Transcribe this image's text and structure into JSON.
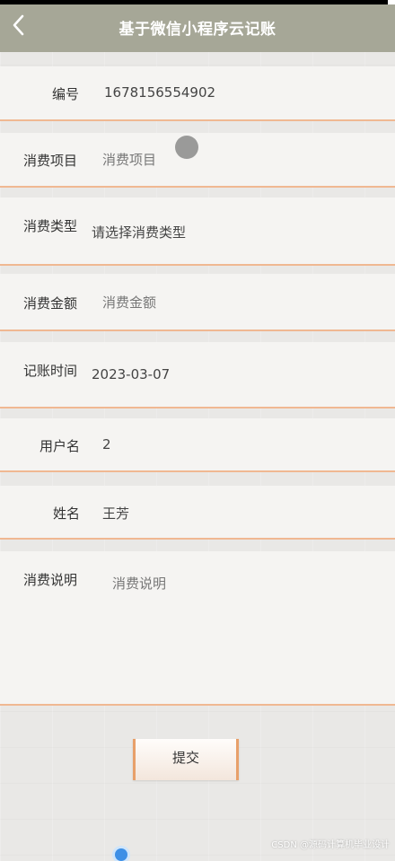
{
  "header": {
    "title": "基于微信小程序云记账",
    "back_icon": "chevron-left-icon"
  },
  "form": {
    "id_label": "编号",
    "id_value": "1678156554902",
    "item_label": "消费项目",
    "item_placeholder": "消费项目",
    "type_label": "消费类型",
    "type_placeholder": "请选择消费类型",
    "amount_label": "消费金额",
    "amount_placeholder": "消费金额",
    "date_label": "记账时间",
    "date_value": "2023-03-07",
    "username_label": "用户名",
    "username_value": "2",
    "name_label": "姓名",
    "name_value": "王芳",
    "desc_label": "消费说明",
    "desc_placeholder": "消费说明"
  },
  "submit_label": "提交",
  "watermark": "CSDN @源码计算机毕业设计",
  "colors": {
    "header_bg": "#a6a797",
    "row_border": "#f0b892",
    "submit_accent": "#e8a06a"
  }
}
